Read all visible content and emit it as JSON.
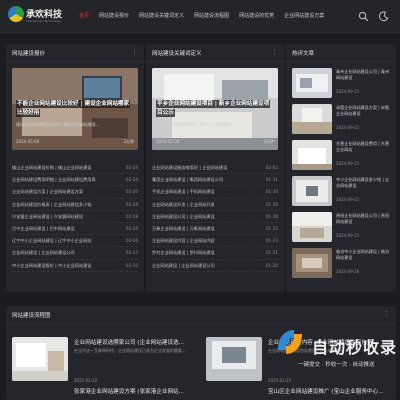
{
  "header": {
    "logo_title": "承欢科技",
    "logo_subtitle": "Chenghuan Technology",
    "nav": [
      "首页",
      "网站建设报价",
      "网站建设关键词定义",
      "网站建设流程图",
      "网站建设的优势",
      "企业网站建设方案"
    ],
    "active_nav": 0
  },
  "panel1": {
    "title": "网站建设报价",
    "feature": {
      "title": "不能企业网站建设比较好 | 建设企业网站哪家比较好用",
      "meta": "建设企业网站哪家比较好 | 建设企业网站哪家...",
      "date": "2024-05-06",
      "read_time": "2分钟"
    },
    "list": [
      {
        "text": "佛山企业网站建设价格 | 佛山企业网站建设",
        "date": "02-24"
      },
      {
        "text": "企业网站建设费用明细 | 企业网站建设费用表",
        "date": "02-24"
      },
      {
        "text": "企业网站建设方案 | 企业网站建设方案",
        "date": "02-20"
      },
      {
        "text": "企业网站建设价格表 | 企业网站建设多少钱",
        "date": "02-18"
      },
      {
        "text": "兴安盟企业网站建设 | 兴安盟网站建设",
        "date": "02-18"
      },
      {
        "text": "巴中企业网站建设 | 巴中网站建设",
        "date": "02-16"
      },
      {
        "text": "辽宁中小企业网站建设 | 辽宁中小企业网站",
        "date": "02-16"
      },
      {
        "text": "企业网站建设 | 企业网站建设公司",
        "date": "02-12"
      },
      {
        "text": "中小企业网站建设报价 | 中小企业网站建设",
        "date": "02-10"
      }
    ]
  },
  "panel2": {
    "title": "网站建设关键词定义",
    "feature": {
      "title": "平乡企业网站建设项目 | 新乡企业网站建设项目公示",
      "meta": "平乡企业网站建设项目 | 新乡企业网站建设...",
      "date": "2024-05-06",
      "read_time": "3分钟"
    },
    "list": [
      {
        "text": "企业网站建设服务哪家好 | 企业网站建设",
        "date": "02-02"
      },
      {
        "text": "集团企业网站建设 | 集团网站建设公司",
        "date": "01-31"
      },
      {
        "text": "手机企业网站建设 | 手机网站建设",
        "date": "01-30"
      },
      {
        "text": "企业网站建设开发 | 企业网站开发",
        "date": "01-29"
      },
      {
        "text": "企业网站建设公司 | 企业网站建设",
        "date": "01-28"
      },
      {
        "text": "万象企业网站建设 | 万象网站建设",
        "date": "01-25"
      },
      {
        "text": "企业网站建设内容 | 企业网站内容",
        "date": "01-23"
      },
      {
        "text": "罗村企业网站建设 | 罗村网站建设",
        "date": "01-21"
      },
      {
        "text": "企业网站建设 | 企业网站建设公司",
        "date": "01-20"
      }
    ]
  },
  "panel3": {
    "title": "热评文章",
    "items": [
      {
        "title": "青州企业网站建设公司 | 青州网站建设",
        "date": "2024-09-21"
      },
      {
        "title": "米脂企业网站建设方案 | 米脂企业网站建设",
        "date": "2024-09-21"
      },
      {
        "title": "东营企业网站建设费用 | 东营企业网站",
        "date": "2024-09-21"
      },
      {
        "title": "中小企业网站建设多少钱 | 企业网站建设",
        "date": "2024-09-21"
      },
      {
        "title": "贵阳企业网站建设公司 | 贵阳网站建设",
        "date": "2024-09-21"
      },
      {
        "title": "临汾中小企业网站建设 | 临汾网站建设",
        "date": "2024-09-26"
      }
    ]
  },
  "panel4": {
    "title": "网站建设流程图",
    "cards": [
      {
        "title": "企业网站建设选哪家公司 (企业网站建设选...",
        "desc": "在当今这一互联网时代，企业网站建设已成为企业发展的重要...",
        "date": "2025-02-22",
        "next_title": "张家港企业网站建设方案 (张家港企业网站..."
      },
      {
        "title": "企业网站建设内容 (企业网站建设内容包括...",
        "desc": "企业网站建设内容包括哪些，企业网站建设...",
        "date": "2025-02-22",
        "next_title": "宝山区企业网站建设推广 (宝山企业服务中心..."
      }
    ]
  },
  "watermark": {
    "text": "自动秒收录",
    "sub": "一键提交 · 秒收一次 · 自动推送"
  },
  "colors": {
    "accent": "#e2382f",
    "background": "#1c1d21",
    "panel": "#25262b"
  }
}
